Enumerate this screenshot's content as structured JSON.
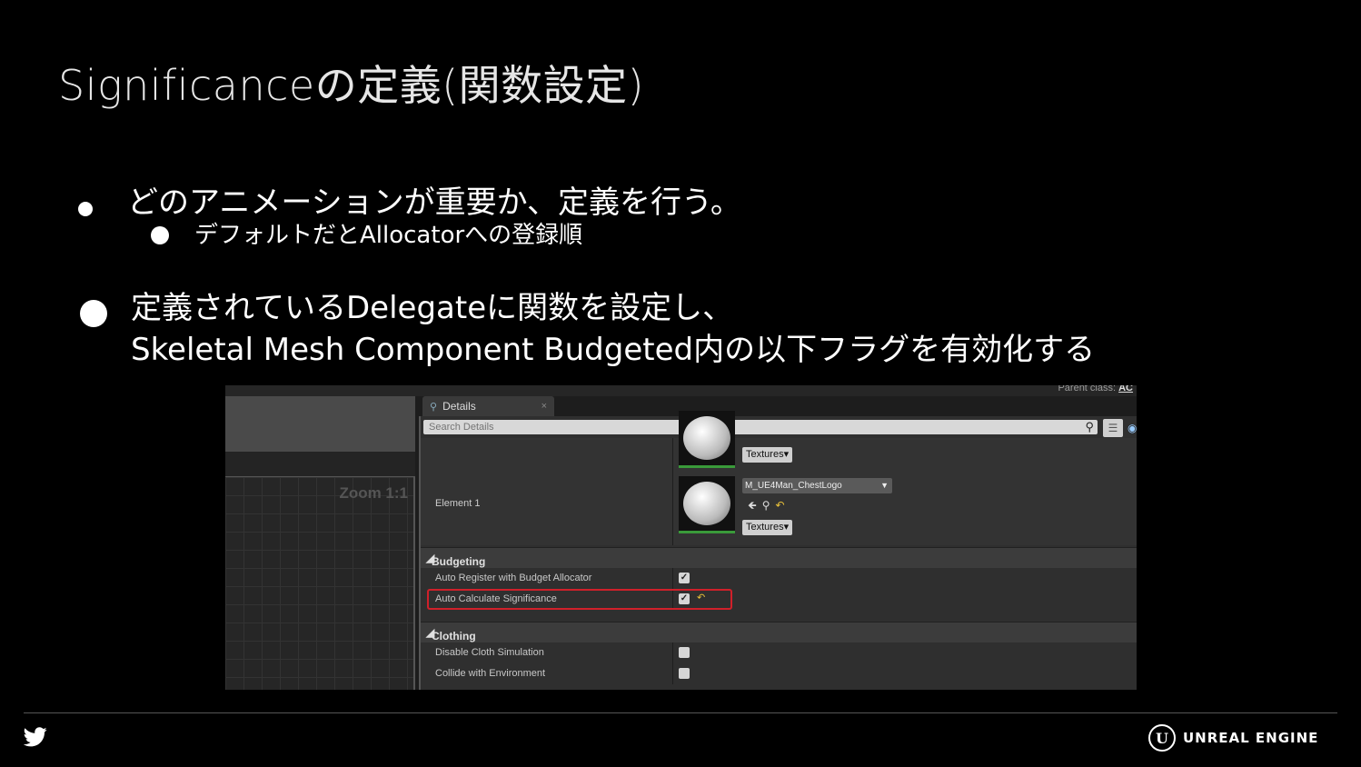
{
  "slide": {
    "title": "Significanceの定義(関数設定)",
    "bullets": [
      {
        "text": "どのアニメーションが重要か、定義を行う。",
        "sub": "デフォルトだとAllocatorへの登録順"
      },
      {
        "text_line1": "定義されているDelegateに関数を設定し、",
        "text_line2": "Skeletal Mesh Component Budgeted内の以下フラグを有効化する"
      }
    ]
  },
  "editor": {
    "parent_class_label": "Parent class:",
    "parent_class_value": "AC",
    "viewport_zoom": "Zoom 1:1",
    "details_tab": {
      "label": "Details",
      "close": "×"
    },
    "search": {
      "placeholder": "Search Details"
    },
    "materials": {
      "element_label": "Element 1",
      "textures_button": "Textures▾",
      "material_name": "M_UE4Man_ChestLogo"
    },
    "categories": [
      {
        "name": "Budgeting",
        "properties": [
          {
            "label": "Auto Register with Budget Allocator",
            "checked": true,
            "highlighted": false
          },
          {
            "label": "Auto Calculate Significance",
            "checked": true,
            "highlighted": true
          }
        ]
      },
      {
        "name": "Clothing",
        "properties": [
          {
            "label": "Disable Cloth Simulation",
            "checked": false
          },
          {
            "label": "Collide with Environment",
            "checked": false
          }
        ]
      }
    ],
    "highlight_color": "#d0202a"
  },
  "footer": {
    "brand": "UNREAL ENGINE",
    "brand_mark": "U"
  }
}
